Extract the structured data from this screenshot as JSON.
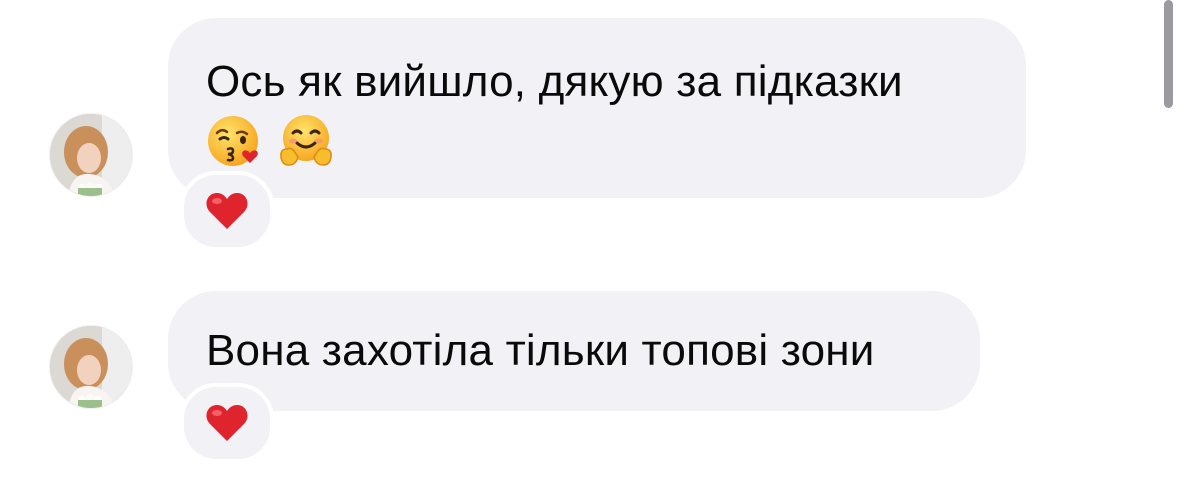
{
  "messages": [
    {
      "text": "Ось як вийшло, дякую за підказки",
      "emojis": [
        "kissing-face-with-heart-icon",
        "hugging-face-icon"
      ],
      "reaction": "red-heart-icon"
    },
    {
      "text": "Вона захотіла тільки топові зони",
      "emojis": [],
      "reaction": "red-heart-icon"
    }
  ],
  "colors": {
    "bubble": "#f2f1f6",
    "text": "#0a0a0a",
    "heart": "#e0242e",
    "scrollbar": "#9b9b9f"
  }
}
